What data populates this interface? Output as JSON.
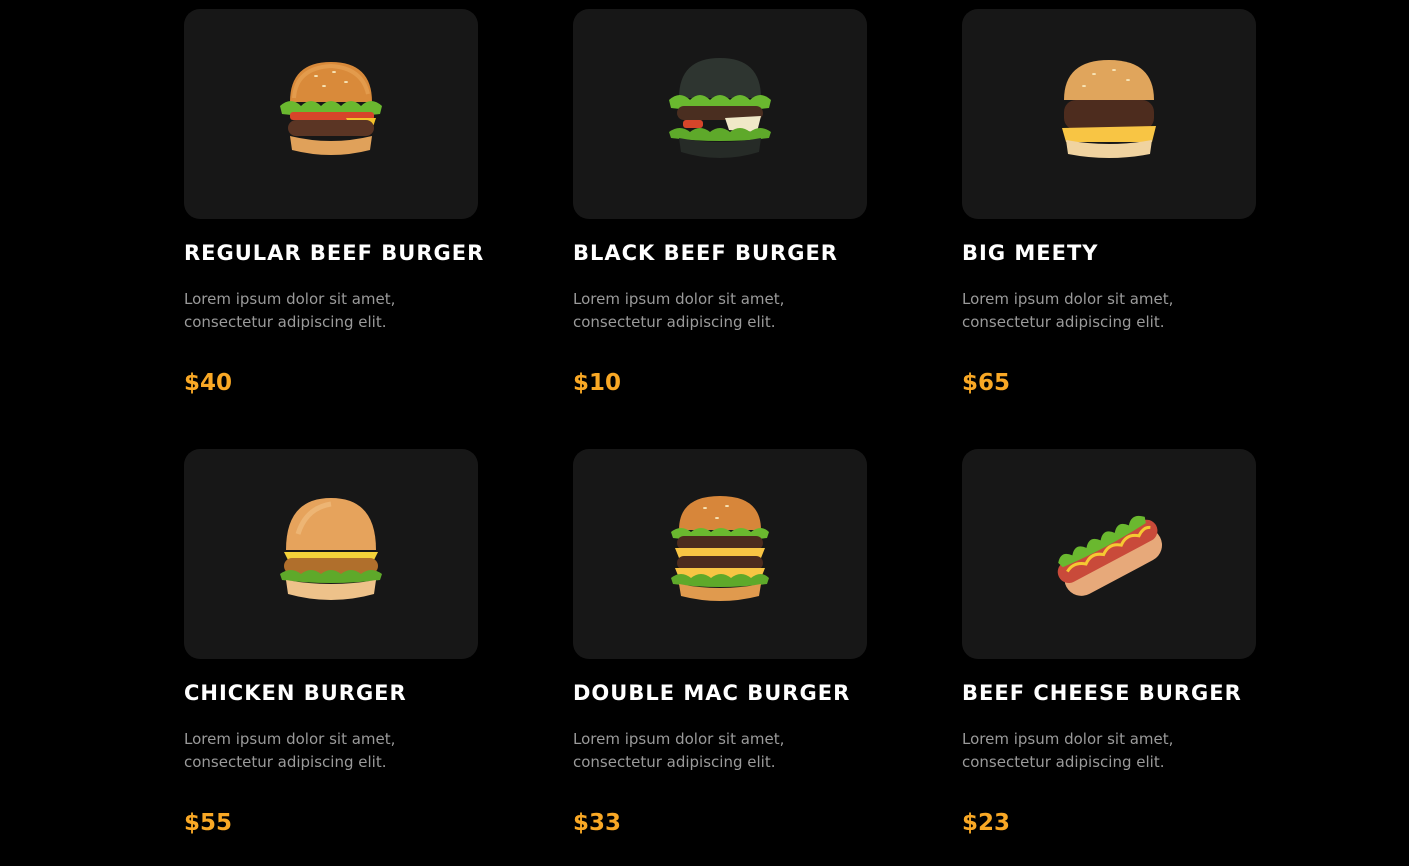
{
  "colors": {
    "background": "#000000",
    "card": "#171717",
    "title": "#ffffff",
    "description": "#9a9a9a",
    "price": "#f9a825"
  },
  "menu": {
    "items": [
      {
        "name": "REGULAR BEEF BURGER",
        "description": "Lorem ipsum dolor sit amet, consectetur adipiscing elit.",
        "price": "$40",
        "image": "regular-burger-image"
      },
      {
        "name": "BLACK BEEF BURGER",
        "description": "Lorem ipsum dolor sit amet, consectetur adipiscing elit.",
        "price": "$10",
        "image": "black-burger-image"
      },
      {
        "name": "BIG MEETY",
        "description": "Lorem ipsum dolor sit amet, consectetur adipiscing elit.",
        "price": "$65",
        "image": "big-meety-image"
      },
      {
        "name": "CHICKEN BURGER",
        "description": "Lorem ipsum dolor sit amet, consectetur adipiscing elit.",
        "price": "$55",
        "image": "chicken-burger-image"
      },
      {
        "name": "DOUBLE MAC BURGER",
        "description": "Lorem ipsum dolor sit amet, consectetur adipiscing elit.",
        "price": "$33",
        "image": "double-burger-image"
      },
      {
        "name": "BEEF CHEESE BURGER",
        "description": "Lorem ipsum dolor sit amet, consectetur adipiscing elit.",
        "price": "$23",
        "image": "hotdog-image"
      }
    ]
  }
}
